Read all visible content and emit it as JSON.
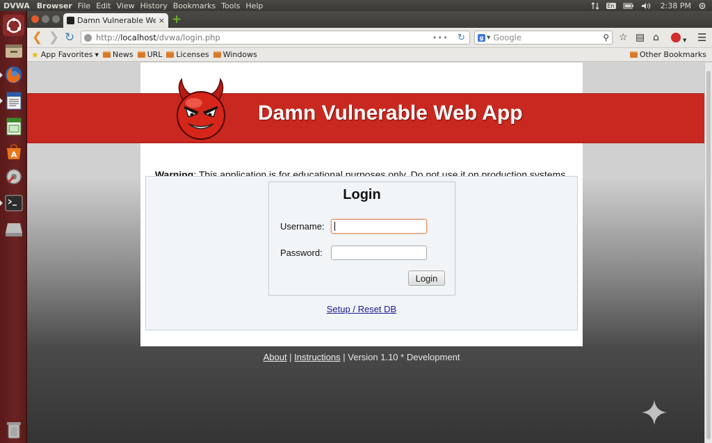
{
  "topbar": {
    "app_name": "DVWA",
    "menus": [
      "Browser",
      "File",
      "Edit",
      "View",
      "History",
      "Bookmarks",
      "Tools",
      "Help"
    ],
    "keyboard_layout": "En",
    "clock": "2:38 PM"
  },
  "launcher": {
    "items": [
      "ubuntu-dash-icon",
      "file-manager-icon",
      "firefox-icon",
      "libreoffice-writer-icon",
      "libreoffice-calc-icon",
      "software-center-icon",
      "system-settings-icon",
      "terminal-icon",
      "drive-icon",
      "trash-icon"
    ]
  },
  "browser": {
    "tab_title": "Damn Vulnerable Web A",
    "tab_close": "×",
    "new_tab": "+",
    "url": {
      "scheme": "http://",
      "host": "localhost",
      "path": "/dvwa/login.php"
    },
    "url_dots": "•••",
    "search_placeholder": "Google",
    "bookmarks": [
      {
        "label": "App Favorites",
        "type": "menu"
      },
      {
        "label": "News",
        "type": "folder"
      },
      {
        "label": "URL",
        "type": "folder"
      },
      {
        "label": "Licenses",
        "type": "folder"
      },
      {
        "label": "Windows",
        "type": "folder"
      }
    ],
    "other_bookmarks": "Other Bookmarks"
  },
  "page": {
    "site_title": "Damn Vulnerable Web App",
    "warning_label": "Warning",
    "warning_text": ": This application is for educational purposes only. Do not use it on production systems.",
    "login": {
      "title": "Login",
      "username_label": "Username:",
      "password_label": "Password:",
      "username_value": "",
      "password_value": "",
      "button": "Login"
    },
    "setup_link": "Setup / Reset DB",
    "footer": {
      "about": "About",
      "sep1": " | ",
      "instructions": "Instructions",
      "sep2": " | ",
      "version": "Version 1.10 * Development"
    }
  },
  "colors": {
    "banner_red": "#c8281f",
    "launcher_bg": "#6b2222",
    "link_blue": "#1a1a8c"
  }
}
